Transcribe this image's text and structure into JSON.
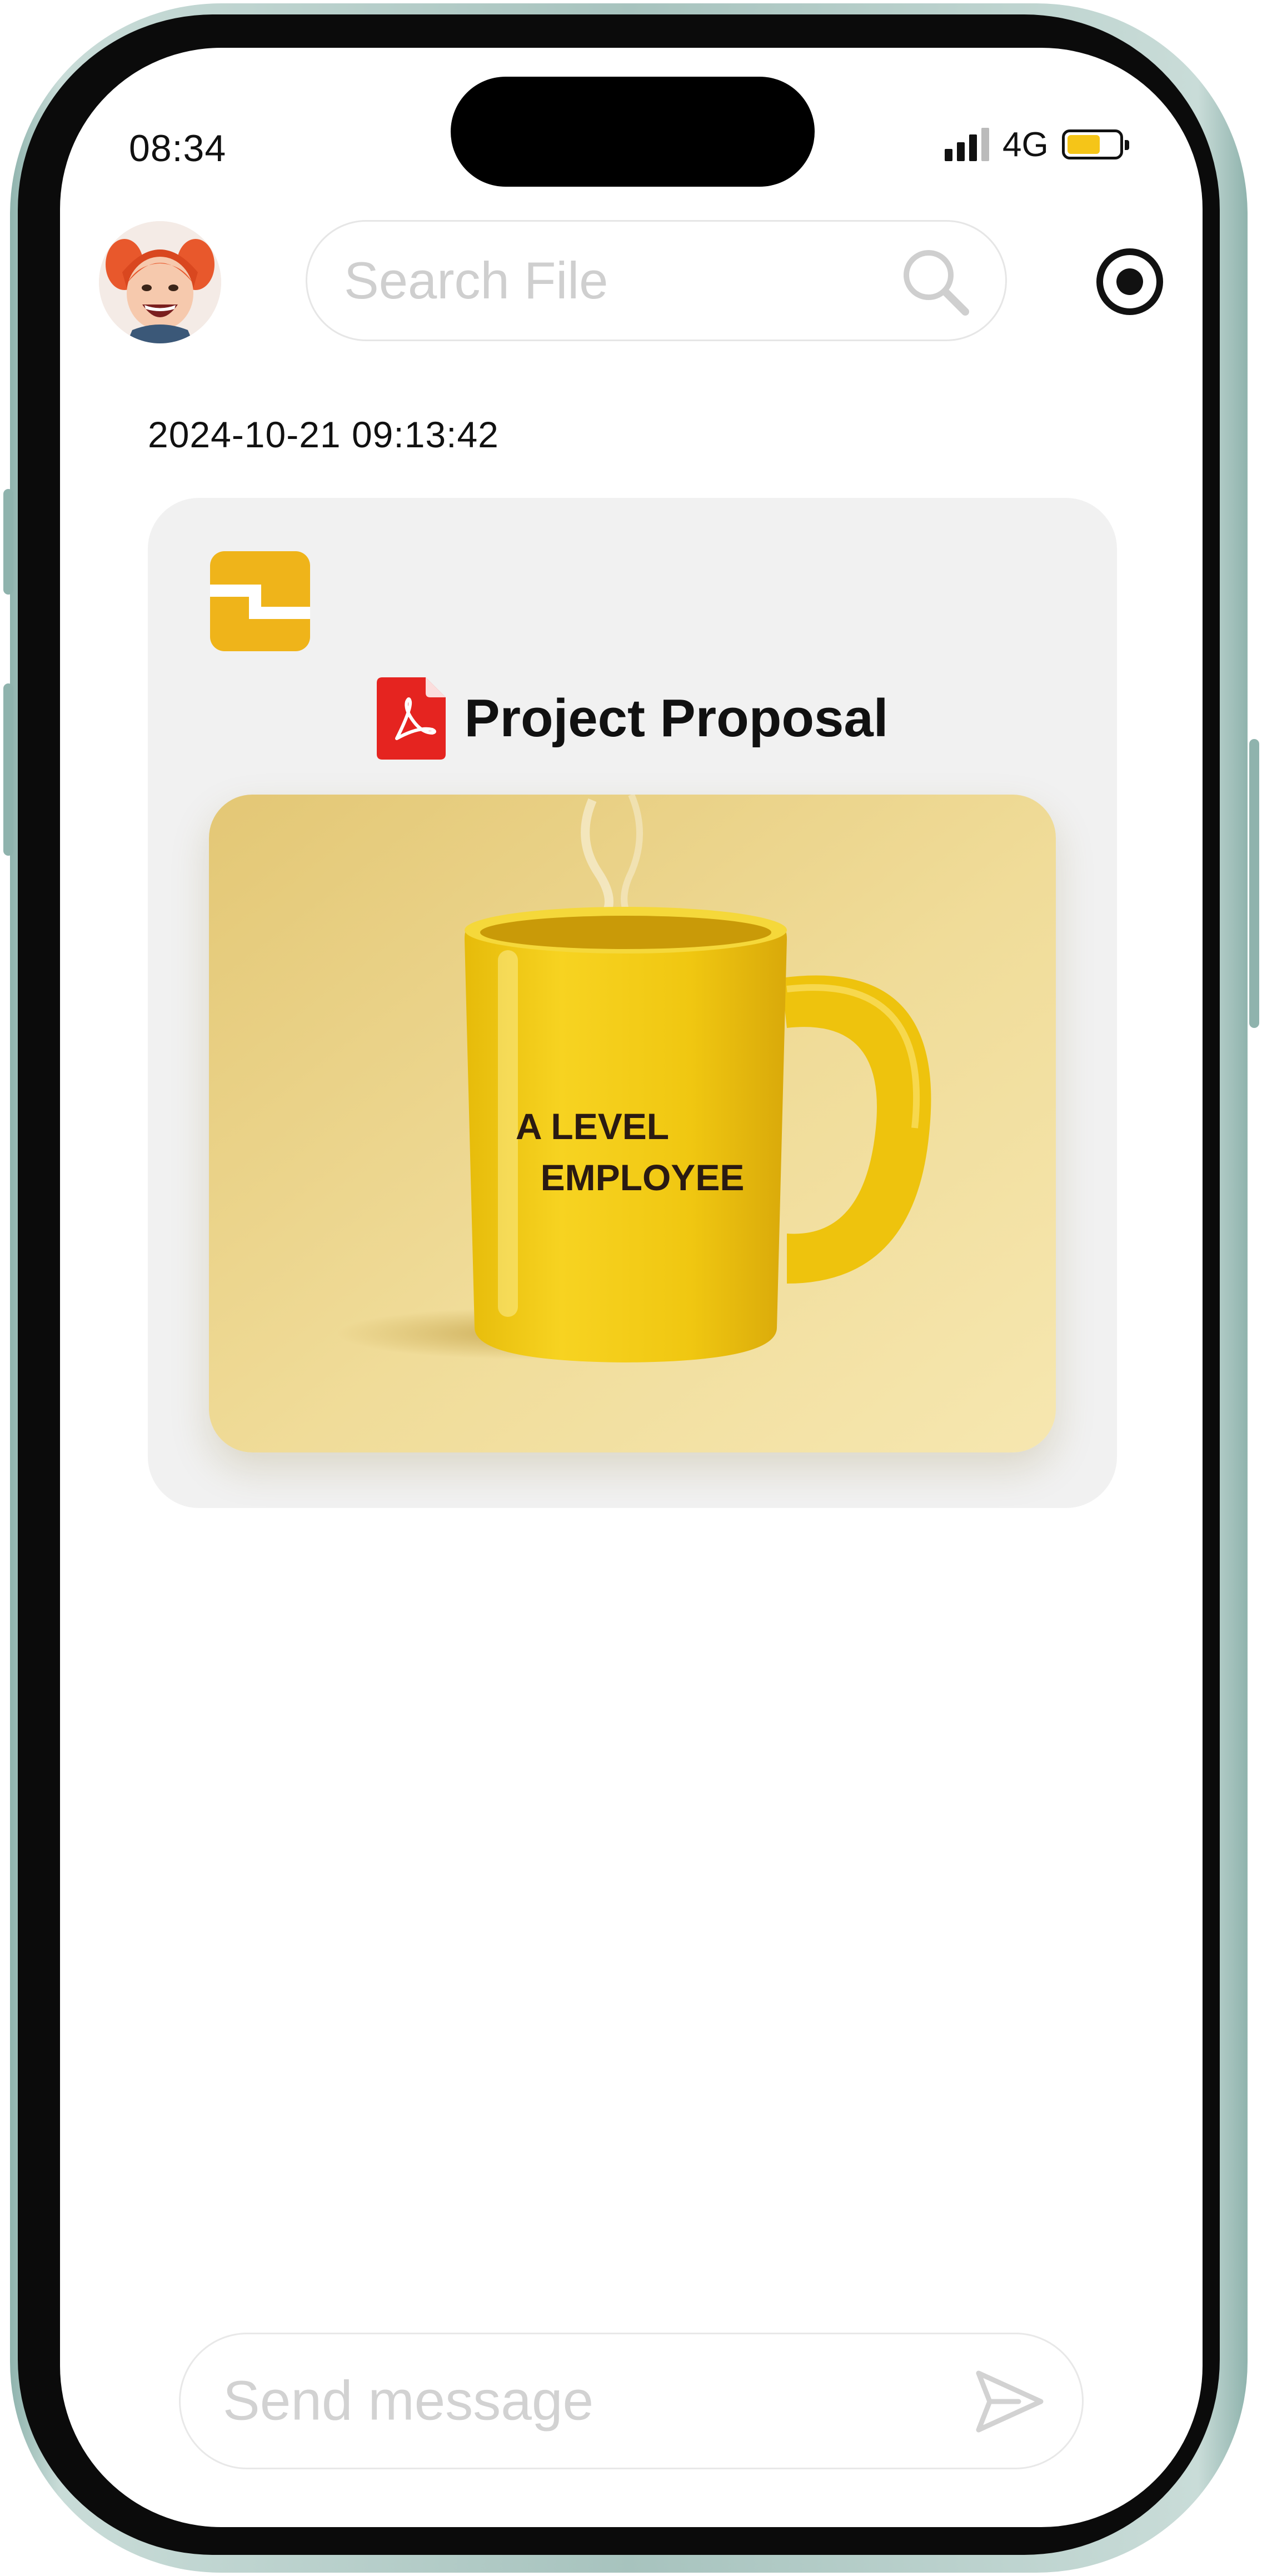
{
  "status_bar": {
    "time": "08:34",
    "network": "4G",
    "icons": [
      "signal-icon",
      "battery-icon"
    ]
  },
  "header": {
    "avatar_icon": "avatar",
    "search_placeholder": "Search File",
    "search_icon": "search-icon",
    "action_icon": "record-icon"
  },
  "message": {
    "timestamp": "2024-10-21 09:13:42",
    "card": {
      "app_icon": "app-logo-icon",
      "file_type_icon": "pdf-icon",
      "file_name": "Project Proposal",
      "preview_text_line1": "A LEVEL",
      "preview_text_line2": "EMPLOYEE"
    }
  },
  "composer": {
    "placeholder": "Send message",
    "send_icon": "send-icon"
  },
  "colors": {
    "accent_yellow": "#f5c518",
    "pdf_red": "#e52420",
    "card_bg": "#f1f1f1",
    "placeholder_gray": "#cfcfcf"
  }
}
